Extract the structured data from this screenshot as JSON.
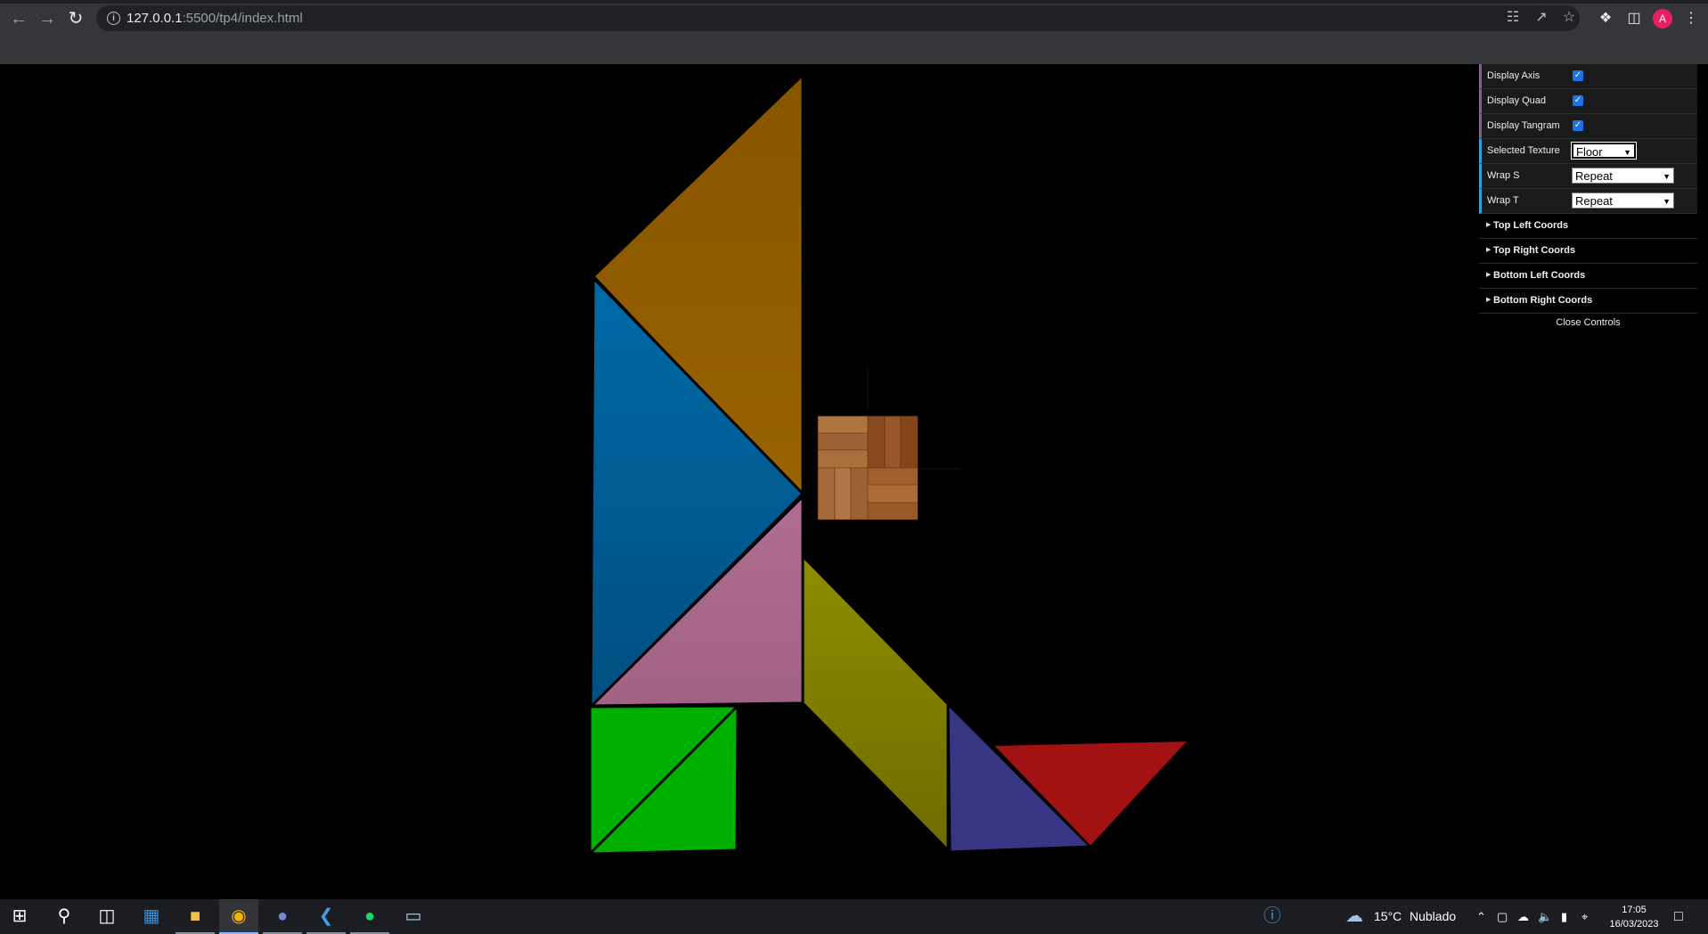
{
  "browser": {
    "url_host": "127.0.0.1",
    "url_path": ":5500/tp4/index.html",
    "avatar_letter": "A"
  },
  "gui": {
    "display_axis": {
      "label": "Display Axis",
      "checked": true
    },
    "display_quad": {
      "label": "Display Quad",
      "checked": true
    },
    "display_tangram": {
      "label": "Display Tangram",
      "checked": true
    },
    "selected_texture": {
      "label": "Selected Texture",
      "value": "Floor"
    },
    "wrap_s": {
      "label": "Wrap S",
      "value": "Repeat"
    },
    "wrap_t": {
      "label": "Wrap T",
      "value": "Repeat"
    },
    "folders": [
      "Top Left Coords",
      "Top Right Coords",
      "Bottom Left Coords",
      "Bottom Right Coords"
    ],
    "close_label": "Close Controls"
  },
  "scene": {
    "pieces": [
      {
        "name": "orange-triangle",
        "color": "#8f5a00"
      },
      {
        "name": "blue-triangle",
        "color": "#005f99"
      },
      {
        "name": "pink-triangle",
        "color": "#a8698a"
      },
      {
        "name": "green-square",
        "color": "#00b000"
      },
      {
        "name": "yellow-parallelogram",
        "color": "#858200"
      },
      {
        "name": "purple-triangle",
        "color": "#393585"
      },
      {
        "name": "red-triangle",
        "color": "#a31212"
      }
    ],
    "texture_quad": {
      "texture": "wood-parquet"
    }
  },
  "taskbar": {
    "weather_temp": "15°C",
    "weather_text": "Nublado",
    "time": "17:05",
    "date": "16/03/2023"
  }
}
